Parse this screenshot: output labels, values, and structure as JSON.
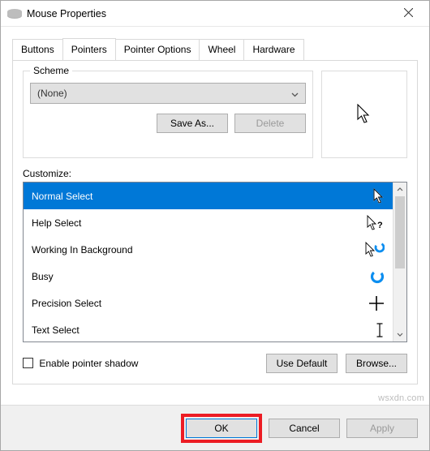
{
  "window": {
    "title": "Mouse Properties"
  },
  "tabs": {
    "items": [
      {
        "label": "Buttons",
        "active": false
      },
      {
        "label": "Pointers",
        "active": true
      },
      {
        "label": "Pointer Options",
        "active": false
      },
      {
        "label": "Wheel",
        "active": false
      },
      {
        "label": "Hardware",
        "active": false
      }
    ]
  },
  "scheme": {
    "legend": "Scheme",
    "selected": "(None)",
    "save_as": "Save As...",
    "delete": "Delete"
  },
  "customize": {
    "label": "Customize:",
    "items": [
      {
        "label": "Normal Select",
        "selected": true
      },
      {
        "label": "Help Select",
        "selected": false
      },
      {
        "label": "Working In Background",
        "selected": false
      },
      {
        "label": "Busy",
        "selected": false
      },
      {
        "label": "Precision Select",
        "selected": false
      },
      {
        "label": "Text Select",
        "selected": false
      }
    ]
  },
  "options": {
    "enable_shadow": "Enable pointer shadow",
    "use_default": "Use Default",
    "browse": "Browse..."
  },
  "footer": {
    "ok": "OK",
    "cancel": "Cancel",
    "apply": "Apply"
  },
  "watermark": "wsxdn.com"
}
